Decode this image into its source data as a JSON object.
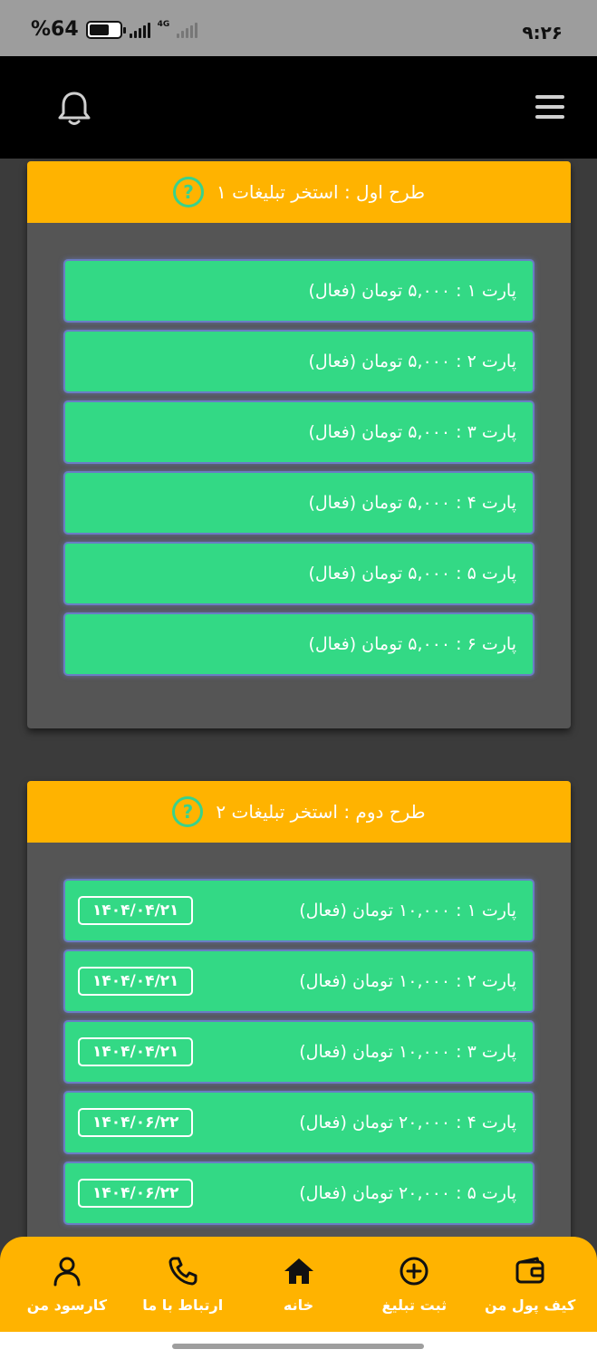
{
  "status_bar": {
    "battery": "%64",
    "network": "4G",
    "time": "۹:۲۶"
  },
  "header": {
    "left_icon": "bell-icon",
    "right_icon": "menu-icon"
  },
  "plans": [
    {
      "title": "طرح اول : استخر تبلیغات ۱",
      "help_icon": "?",
      "parts": [
        {
          "label": "پارت ۱ : ۵,۰۰۰ تومان (فعال)",
          "date": ""
        },
        {
          "label": "پارت ۲ : ۵,۰۰۰ تومان (فعال)",
          "date": ""
        },
        {
          "label": "پارت ۳ : ۵,۰۰۰ تومان (فعال)",
          "date": ""
        },
        {
          "label": "پارت ۴ : ۵,۰۰۰ تومان (فعال)",
          "date": ""
        },
        {
          "label": "پارت ۵ : ۵,۰۰۰ تومان (فعال)",
          "date": ""
        },
        {
          "label": "پارت ۶ : ۵,۰۰۰ تومان (فعال)",
          "date": ""
        }
      ]
    },
    {
      "title": "طرح دوم : استخر تبلیغات ۲",
      "help_icon": "?",
      "parts": [
        {
          "label": "پارت ۱ : ۱۰,۰۰۰ تومان (فعال)",
          "date": "۱۴۰۴/۰۴/۲۱"
        },
        {
          "label": "پارت ۲ : ۱۰,۰۰۰ تومان (فعال)",
          "date": "۱۴۰۴/۰۴/۲۱"
        },
        {
          "label": "پارت ۳ : ۱۰,۰۰۰ تومان (فعال)",
          "date": "۱۴۰۴/۰۴/۲۱"
        },
        {
          "label": "پارت ۴ : ۲۰,۰۰۰ تومان (فعال)",
          "date": "۱۴۰۴/۰۶/۲۲"
        },
        {
          "label": "پارت ۵ : ۲۰,۰۰۰ تومان (فعال)",
          "date": "۱۴۰۴/۰۶/۲۲"
        }
      ]
    }
  ],
  "bottom_nav": [
    {
      "label": "کیف پول من",
      "icon": "wallet-icon"
    },
    {
      "label": "ثبت تبلیغ",
      "icon": "plus-circle-icon"
    },
    {
      "label": "خانه",
      "icon": "home-icon"
    },
    {
      "label": "ارتباط با ما",
      "icon": "phone-icon"
    },
    {
      "label": "کارسود من",
      "icon": "user-icon"
    }
  ],
  "colors": {
    "accent": "#ffb300",
    "part_green": "#33d985",
    "help_green": "#39d28b",
    "card_bg": "#555555",
    "page_bg": "#3b3b3b"
  }
}
